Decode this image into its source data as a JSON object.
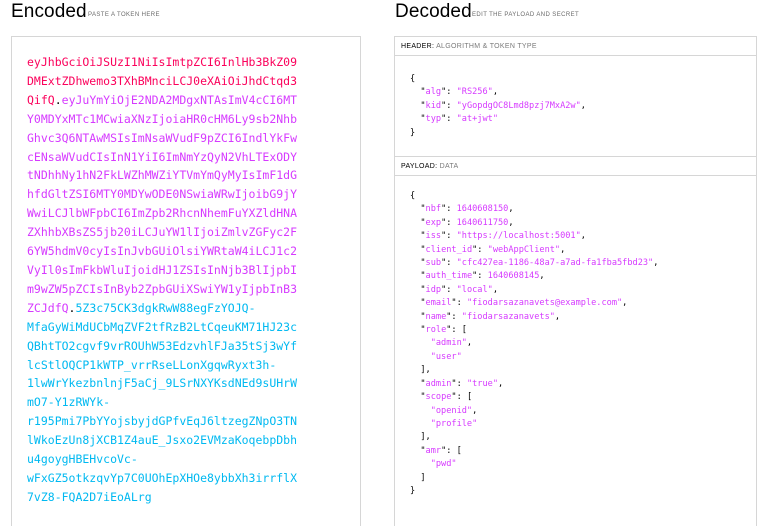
{
  "encoded": {
    "title": "Encoded",
    "subtitle": "PASTE A TOKEN HERE",
    "header_lines": [
      "eyJhbGciOiJSUzI1NiIsImtpZCI6InlHb3BkZ09",
      "DMExtZDhwemo3TXhBMnciLCJ0eXAiOiJhdCtqd3",
      "QifQ"
    ],
    "payload_lines": [
      "eyJuYmYiOjE2NDA2MDgxNTAsImV4cCI6MT",
      "Y0MDYxMTc1MCwiaXNzIjoiaHR0cHM6Ly9sb2Nhb",
      "Ghvc3Q6NTAwMSIsImNsaWVudF9pZCI6IndlYkFw",
      "cENsaWVudCIsInN1YiI6ImNmYzQyN2VhLTExODY",
      "tNDhhNy1hN2FkLWZhMWZiYTVmYmQyMyIsImF1dG",
      "hfdGltZSI6MTY0MDYwODE0NSwiaWRwIjoibG9jY",
      "WwiLCJlbWFpbCI6ImZpb2RhcnNhemFuYXZldHNA",
      "ZXhhbXBsZS5jb20iLCJuYW1lIjoiZmlvZGFyc2F",
      "6YW5hdmV0cyIsInJvbGUiOlsiYWRtaW4iLCJ1c2",
      "VyIl0sImFkbWluIjoidHJ1ZSIsInNjb3BlIjpbI",
      "m9wZW5pZCIsInByb2ZpbGUiXSwiYW1yIjpbInB3",
      "ZCJdfQ"
    ],
    "signature_lines": [
      "5Z3c75CK3dgkRwW88egFzYOJQ-",
      "MfaGyWiMdUCbMqZVF2tfRzB2LtCqeuKM71HJ23c",
      "QBhtTO2cgvf9vrROUhW53EdzvhlFJa35tSj3wYf",
      "lcStlOQCP1kWTP_vrrRseLLonXgqwRyxt3h-",
      "1lwWrYkezbnlnjF5aCj_9LSrNXYKsdNEd9sUHrW",
      "mO7-Y1zRWYk-",
      "r195Pmi7PbYYojsbyjdGPfvEqJ6ltzegZNpO3TN",
      "lWkoEzUn8jXCB1Z4auE_Jsxo2EVMzaKoqebpDbh",
      "u4goygHBEHvcoVc-",
      "wFxGZ5otkzqvYp7C0UOhEpXHOe8ybbXh3irrflX",
      "7vZ8-FQA2D7iEoALrg"
    ]
  },
  "decoded": {
    "title": "Decoded",
    "subtitle": "EDIT THE PAYLOAD AND SECRET",
    "header_section": {
      "label": "HEADER:",
      "sublabel": "ALGORITHM & TOKEN TYPE"
    },
    "payload_section": {
      "label": "PAYLOAD:",
      "sublabel": "DATA"
    },
    "header_json": [
      {
        "indent": 0,
        "text": "{"
      },
      {
        "indent": 1,
        "key": "alg",
        "value": "\"RS256\"",
        "comma": true
      },
      {
        "indent": 1,
        "key": "kid",
        "value": "\"yGopdgOC8Lmd8pzj7MxA2w\"",
        "comma": true
      },
      {
        "indent": 1,
        "key": "typ",
        "value": "\"at+jwt\"",
        "comma": false
      },
      {
        "indent": 0,
        "text": "}"
      }
    ],
    "payload_json": [
      {
        "indent": 0,
        "text": "{"
      },
      {
        "indent": 1,
        "key": "nbf",
        "value": "1640608150",
        "comma": true
      },
      {
        "indent": 1,
        "key": "exp",
        "value": "1640611750",
        "comma": true
      },
      {
        "indent": 1,
        "key": "iss",
        "value": "\"https://localhost:5001\"",
        "comma": true
      },
      {
        "indent": 1,
        "key": "client_id",
        "value": "\"webAppClient\"",
        "comma": true
      },
      {
        "indent": 1,
        "key": "sub",
        "value": "\"cfc427ea-1186-48a7-a7ad-fa1fba5fbd23\"",
        "comma": true
      },
      {
        "indent": 1,
        "key": "auth_time",
        "value": "1640608145",
        "comma": true
      },
      {
        "indent": 1,
        "key": "idp",
        "value": "\"local\"",
        "comma": true
      },
      {
        "indent": 1,
        "key": "email",
        "value": "\"fiodarsazanavets@example.com\"",
        "comma": true
      },
      {
        "indent": 1,
        "key": "name",
        "value": "\"fiodarsazanavets\"",
        "comma": true
      },
      {
        "indent": 1,
        "key": "role",
        "value": "[",
        "comma": false
      },
      {
        "indent": 2,
        "value": "\"admin\"",
        "comma": true
      },
      {
        "indent": 2,
        "value": "\"user\"",
        "comma": false
      },
      {
        "indent": 1,
        "text": "],"
      },
      {
        "indent": 1,
        "key": "admin",
        "value": "\"true\"",
        "comma": true
      },
      {
        "indent": 1,
        "key": "scope",
        "value": "[",
        "comma": false
      },
      {
        "indent": 2,
        "value": "\"openid\"",
        "comma": true
      },
      {
        "indent": 2,
        "value": "\"profile\"",
        "comma": false
      },
      {
        "indent": 1,
        "text": "],"
      },
      {
        "indent": 1,
        "key": "amr",
        "value": "[",
        "comma": false
      },
      {
        "indent": 2,
        "value": "\"pwd\"",
        "comma": false
      },
      {
        "indent": 1,
        "text": "]"
      },
      {
        "indent": 0,
        "text": "}"
      }
    ]
  },
  "colors": {
    "header": "#fb015b",
    "payload": "#d63aff",
    "signature": "#00b9f1"
  }
}
